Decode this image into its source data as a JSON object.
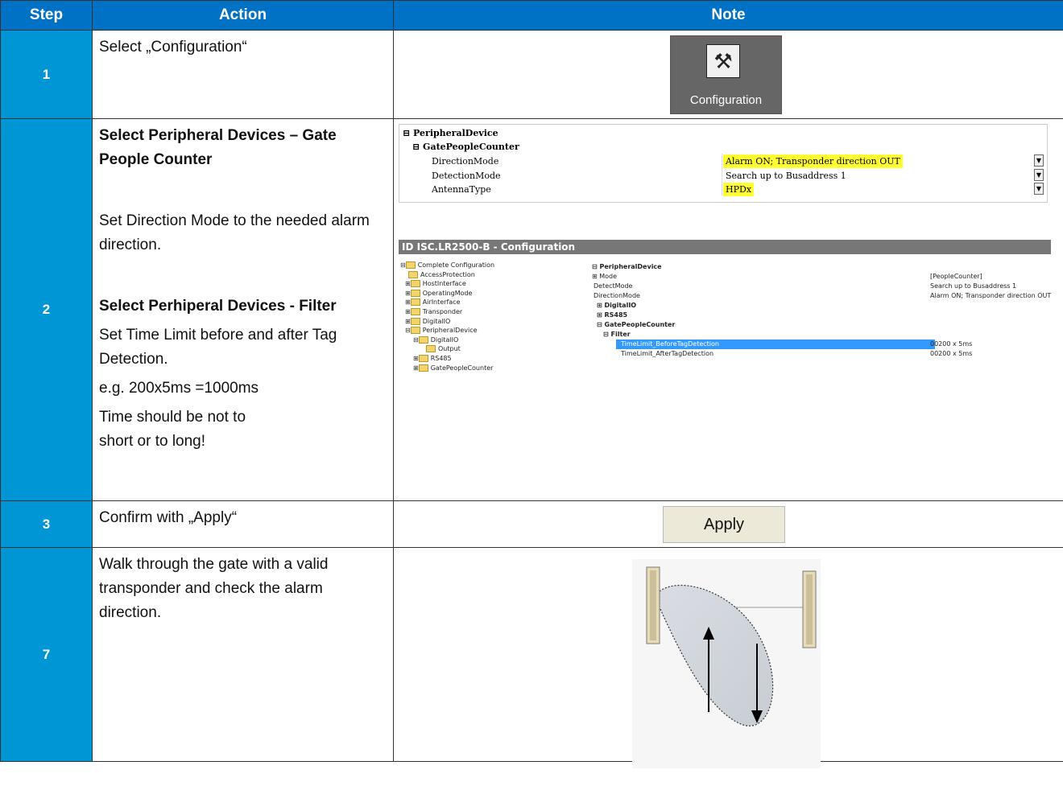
{
  "headers": {
    "step": "Step",
    "action": "Action",
    "note": "Note"
  },
  "rows": {
    "r1": {
      "step": "1",
      "action": "Select „Configuration“",
      "icon_label": "Configuration"
    },
    "r2": {
      "step": "2",
      "title1": "Select Peripheral Devices – Gate People Counter",
      "text1": "Set Direction Mode to the needed alarm direction.",
      "title2": "Select Perhiperal Devices - Filter",
      "text2": "Set Time Limit before and after Tag Detection.",
      "text3": "e.g. 200x5ms =1000ms",
      "text4": "Time should be not to short or to long!"
    },
    "r3": {
      "step": "3",
      "action": "Confirm with  „Apply“",
      "button": "Apply"
    },
    "r4": {
      "step": "7",
      "action": "Walk through the gate with a valid transponder and check the alarm direction."
    }
  },
  "grid1": {
    "peripheral": "PeripheralDevice",
    "gpc": "GatePeopleCounter",
    "dir_label": "DirectionMode",
    "dir_value": "Alarm ON; Transponder direction OUT",
    "det_label": "DetectionMode",
    "det_value": "Search up to Busaddress 1",
    "ant_label": "AntennaType",
    "ant_value": "HPDx"
  },
  "window": {
    "title": "ID ISC.LR2500-B - Configuration",
    "tree": [
      "Complete Configuration",
      "AccessProtection",
      "HostInterface",
      "OperatingMode",
      "AirInterface",
      "Transponder",
      "DigitalIO",
      "PeripheralDevice",
      "DigitalIO",
      "Output",
      "RS485",
      "GatePeopleCounter"
    ],
    "props": {
      "peripheral": "PeripheralDevice",
      "mode": "Mode",
      "mode_v": "[PeopleCounter]",
      "detect": "DetectMode",
      "detect_v": "Search up to Busaddress 1",
      "dir": "DirectionMode",
      "dir_v": "Alarm ON; Transponder direction OUT",
      "dio": "DigitalIO",
      "rs": "RS485",
      "gpc": "GatePeopleCounter",
      "filter": "Filter",
      "before": "TimeLimit_BeforeTagDetection",
      "before_v": "00200 x 5ms",
      "after": "TimeLimit_AfterTagDetection",
      "after_v": "00200 x 5ms"
    }
  }
}
